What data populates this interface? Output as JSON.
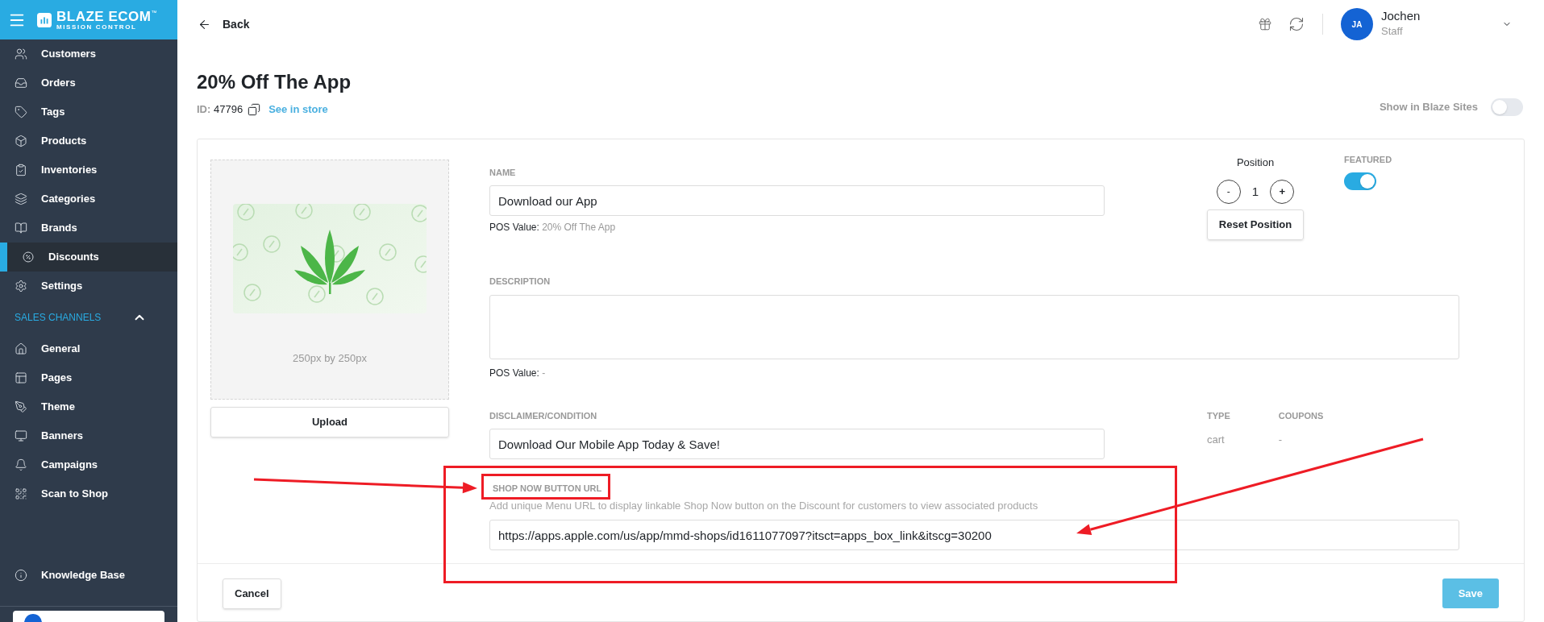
{
  "brand": {
    "name": "BLAZE ECOM",
    "trademark": "™",
    "tagline": "MISSION CONTROL"
  },
  "sidebar": {
    "items": [
      {
        "label": "Customers",
        "selected": false
      },
      {
        "label": "Orders",
        "selected": false
      },
      {
        "label": "Tags",
        "selected": false
      },
      {
        "label": "Products",
        "selected": false
      },
      {
        "label": "Inventories",
        "selected": false
      },
      {
        "label": "Categories",
        "selected": false
      },
      {
        "label": "Brands",
        "selected": false
      },
      {
        "label": "Discounts",
        "selected": true
      },
      {
        "label": "Settings",
        "selected": false
      }
    ],
    "section": {
      "title": "SALES CHANNELS",
      "expanded": true,
      "items": [
        {
          "label": "General",
          "selected": false
        },
        {
          "label": "Pages",
          "selected": false
        },
        {
          "label": "Theme",
          "selected": false
        },
        {
          "label": "Banners",
          "selected": false
        },
        {
          "label": "Campaigns",
          "selected": false
        },
        {
          "label": "Scan to Shop",
          "selected": false
        }
      ]
    },
    "footer_items": [
      {
        "label": "Knowledge Base",
        "selected": false
      }
    ]
  },
  "header": {
    "back": "Back",
    "user": {
      "initials": "JA",
      "name": "Jochen",
      "role": "Staff"
    }
  },
  "page": {
    "title": "20% Off The App",
    "id_label": "ID:",
    "id_value": "47796",
    "store_link": "See in store",
    "show_in_sites": {
      "label": "Show in Blaze Sites",
      "on": false
    }
  },
  "form": {
    "image_hint": "250px by 250px",
    "upload": "Upload",
    "name": {
      "label": "NAME",
      "value": "Download our App",
      "pos_label": "POS Value:",
      "pos_value": "20% Off The App"
    },
    "position": {
      "label": "Position",
      "minus": "-",
      "value": "1",
      "plus": "+",
      "reset": "Reset Position"
    },
    "featured": {
      "label": "FEATURED",
      "on": true
    },
    "description": {
      "label": "DESCRIPTION",
      "pos_label": "POS Value:",
      "pos_value": "-"
    },
    "disclaimer": {
      "label": "DISCLAIMER/CONDITION",
      "value": "Download Our Mobile App Today & Save!"
    },
    "info": [
      {
        "label": "TYPE",
        "value": "cart"
      },
      {
        "label": "COUPONS",
        "value": "-"
      }
    ],
    "shop_now": {
      "label": "SHOP NOW BUTTON URL",
      "help": "Add unique Menu URL to display linkable Shop Now button on the Discount for customers to view associated products",
      "value": "https://apps.apple.com/us/app/mmd-shops/id1611077097?itsct=apps_box_link&itscg=30200"
    },
    "cancel": "Cancel",
    "save": "Save"
  },
  "annotations": [
    {
      "kind": "rectangle"
    },
    {
      "kind": "rectangle"
    },
    {
      "kind": "arrow"
    },
    {
      "kind": "arrow"
    }
  ]
}
